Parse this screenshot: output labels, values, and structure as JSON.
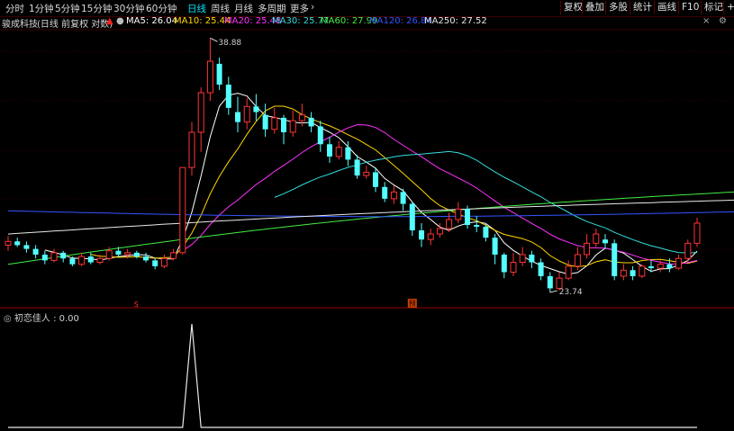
{
  "toolbar": {
    "timeframes": [
      "分时",
      "1分钟",
      "5分钟",
      "15分钟",
      "30分钟",
      "60分钟",
      "日线",
      "周线",
      "月线",
      "多周期",
      "更多"
    ],
    "active_timeframe": "日线",
    "right_buttons": [
      "复权",
      "叠加",
      "多股",
      "统计",
      "画线",
      "F10",
      "标记",
      "+"
    ]
  },
  "title": {
    "stock_name": "骏成科技",
    "mode": "(日线 前复权 对数)"
  },
  "ma_legend": [
    {
      "label": "MA5: 26.04",
      "color": "#ffffff"
    },
    {
      "label": "MA10: 25.44",
      "color": "#ffd700"
    },
    {
      "label": "MA20: 25.48",
      "color": "#ff33ff"
    },
    {
      "label": "MA30: 25.77",
      "color": "#33dddd"
    },
    {
      "label": "MA60: 27.99",
      "color": "#44ee44"
    },
    {
      "label": "MA120: 26.84",
      "color": "#3355ff"
    },
    {
      "label": "MA250: 27.52",
      "color": "#e8e8e8"
    }
  ],
  "oscillator": {
    "label": "初恋佳人 : 0.00",
    "peak_day": 20
  },
  "chart_data": {
    "type": "candlestick",
    "annotations": {
      "high": "38.88",
      "low": "23.74",
      "buy_marker": "S",
      "forecast_marker": "预"
    },
    "candles": [
      {
        "o": 25.0,
        "c": 25.2,
        "h": 25.5,
        "l": 24.7
      },
      {
        "o": 25.2,
        "c": 25.0,
        "h": 25.4,
        "l": 24.9
      },
      {
        "o": 25.0,
        "c": 24.8,
        "h": 25.2,
        "l": 24.6
      },
      {
        "o": 24.8,
        "c": 24.5,
        "h": 25.0,
        "l": 24.3
      },
      {
        "o": 24.5,
        "c": 24.2,
        "h": 24.7,
        "l": 24.0
      },
      {
        "o": 24.2,
        "c": 24.6,
        "h": 24.8,
        "l": 24.1
      },
      {
        "o": 24.6,
        "c": 24.3,
        "h": 24.7,
        "l": 24.1
      },
      {
        "o": 24.3,
        "c": 24.0,
        "h": 24.4,
        "l": 23.9
      },
      {
        "o": 24.0,
        "c": 24.4,
        "h": 24.6,
        "l": 23.9
      },
      {
        "o": 24.4,
        "c": 24.1,
        "h": 24.6,
        "l": 24.0
      },
      {
        "o": 24.1,
        "c": 24.3,
        "h": 24.5,
        "l": 24.0
      },
      {
        "o": 24.3,
        "c": 24.7,
        "h": 24.9,
        "l": 24.2
      },
      {
        "o": 24.7,
        "c": 24.5,
        "h": 24.9,
        "l": 24.4
      },
      {
        "o": 24.5,
        "c": 24.6,
        "h": 24.8,
        "l": 24.3
      },
      {
        "o": 24.6,
        "c": 24.4,
        "h": 24.7,
        "l": 24.3
      },
      {
        "o": 24.4,
        "c": 24.2,
        "h": 24.6,
        "l": 24.1
      },
      {
        "o": 24.2,
        "c": 23.9,
        "h": 24.3,
        "l": 23.74
      },
      {
        "o": 23.9,
        "c": 24.3,
        "h": 24.5,
        "l": 23.8
      },
      {
        "o": 24.3,
        "c": 24.6,
        "h": 24.8,
        "l": 24.2
      },
      {
        "o": 24.6,
        "c": 29.5,
        "h": 29.5,
        "l": 24.5
      },
      {
        "o": 29.5,
        "c": 31.8,
        "h": 32.5,
        "l": 29.0
      },
      {
        "o": 31.8,
        "c": 34.6,
        "h": 35.0,
        "l": 30.5
      },
      {
        "o": 34.6,
        "c": 37.0,
        "h": 38.88,
        "l": 34.0
      },
      {
        "o": 36.8,
        "c": 35.2,
        "h": 37.3,
        "l": 34.8
      },
      {
        "o": 35.2,
        "c": 33.5,
        "h": 35.8,
        "l": 33.0
      },
      {
        "o": 33.2,
        "c": 32.5,
        "h": 34.3,
        "l": 31.8
      },
      {
        "o": 32.5,
        "c": 33.6,
        "h": 34.2,
        "l": 32.0
      },
      {
        "o": 33.6,
        "c": 33.2,
        "h": 34.5,
        "l": 32.6
      },
      {
        "o": 33.0,
        "c": 32.0,
        "h": 33.8,
        "l": 31.5
      },
      {
        "o": 32.0,
        "c": 32.8,
        "h": 33.5,
        "l": 31.7
      },
      {
        "o": 32.8,
        "c": 31.8,
        "h": 33.0,
        "l": 31.0
      },
      {
        "o": 31.8,
        "c": 32.6,
        "h": 33.3,
        "l": 31.5
      },
      {
        "o": 32.6,
        "c": 33.0,
        "h": 33.8,
        "l": 32.2
      },
      {
        "o": 32.8,
        "c": 32.2,
        "h": 33.2,
        "l": 31.8
      },
      {
        "o": 32.2,
        "c": 31.0,
        "h": 32.6,
        "l": 30.5
      },
      {
        "o": 31.0,
        "c": 30.2,
        "h": 31.5,
        "l": 29.8
      },
      {
        "o": 30.2,
        "c": 30.8,
        "h": 31.2,
        "l": 30.0
      },
      {
        "o": 30.8,
        "c": 30.0,
        "h": 31.2,
        "l": 29.6
      },
      {
        "o": 30.0,
        "c": 29.0,
        "h": 30.3,
        "l": 28.8
      },
      {
        "o": 29.0,
        "c": 29.2,
        "h": 29.6,
        "l": 28.8
      },
      {
        "o": 29.2,
        "c": 28.3,
        "h": 29.5,
        "l": 28.0
      },
      {
        "o": 28.3,
        "c": 27.6,
        "h": 28.6,
        "l": 27.4
      },
      {
        "o": 27.6,
        "c": 28.0,
        "h": 28.4,
        "l": 27.3
      },
      {
        "o": 28.0,
        "c": 27.3,
        "h": 28.2,
        "l": 26.9
      },
      {
        "o": 27.3,
        "c": 25.8,
        "h": 27.4,
        "l": 25.5
      },
      {
        "o": 25.8,
        "c": 25.3,
        "h": 26.2,
        "l": 24.9
      },
      {
        "o": 25.3,
        "c": 25.6,
        "h": 25.9,
        "l": 25.0
      },
      {
        "o": 25.6,
        "c": 25.9,
        "h": 26.2,
        "l": 25.4
      },
      {
        "o": 25.9,
        "c": 26.4,
        "h": 26.8,
        "l": 25.7
      },
      {
        "o": 26.4,
        "c": 27.0,
        "h": 27.4,
        "l": 26.2
      },
      {
        "o": 27.0,
        "c": 26.1,
        "h": 27.2,
        "l": 25.9
      },
      {
        "o": 26.1,
        "c": 26.0,
        "h": 26.6,
        "l": 25.7
      },
      {
        "o": 26.0,
        "c": 25.4,
        "h": 26.2,
        "l": 25.2
      },
      {
        "o": 25.4,
        "c": 24.5,
        "h": 25.6,
        "l": 24.0
      },
      {
        "o": 24.5,
        "c": 23.6,
        "h": 24.6,
        "l": 23.3
      },
      {
        "o": 23.6,
        "c": 24.1,
        "h": 24.6,
        "l": 23.4
      },
      {
        "o": 24.1,
        "c": 24.5,
        "h": 24.9,
        "l": 23.9
      },
      {
        "o": 24.5,
        "c": 24.1,
        "h": 24.7,
        "l": 23.8
      },
      {
        "o": 24.1,
        "c": 23.4,
        "h": 24.3,
        "l": 23.2
      },
      {
        "o": 23.4,
        "c": 22.8,
        "h": 23.6,
        "l": 22.6
      },
      {
        "o": 22.8,
        "c": 23.3,
        "h": 23.6,
        "l": 22.7
      },
      {
        "o": 23.3,
        "c": 23.9,
        "h": 24.2,
        "l": 23.2
      },
      {
        "o": 23.9,
        "c": 24.5,
        "h": 24.9,
        "l": 23.7
      },
      {
        "o": 24.5,
        "c": 25.1,
        "h": 25.6,
        "l": 24.3
      },
      {
        "o": 25.1,
        "c": 25.6,
        "h": 25.9,
        "l": 24.9
      },
      {
        "o": 25.3,
        "c": 25.1,
        "h": 25.6,
        "l": 24.8
      },
      {
        "o": 25.1,
        "c": 23.4,
        "h": 25.3,
        "l": 23.2
      },
      {
        "o": 23.4,
        "c": 23.7,
        "h": 24.0,
        "l": 23.2
      },
      {
        "o": 23.7,
        "c": 23.4,
        "h": 23.9,
        "l": 23.2
      },
      {
        "o": 23.4,
        "c": 23.9,
        "h": 24.0,
        "l": 23.3
      },
      {
        "o": 23.9,
        "c": 23.8,
        "h": 24.2,
        "l": 23.6
      },
      {
        "o": 23.8,
        "c": 24.0,
        "h": 24.2,
        "l": 23.6
      },
      {
        "o": 24.0,
        "c": 23.8,
        "h": 24.3,
        "l": 23.6
      },
      {
        "o": 23.8,
        "c": 24.3,
        "h": 24.5,
        "l": 23.7
      },
      {
        "o": 24.3,
        "c": 25.1,
        "h": 25.3,
        "l": 24.1
      },
      {
        "o": 25.1,
        "c": 26.2,
        "h": 26.5,
        "l": 24.9
      }
    ]
  }
}
